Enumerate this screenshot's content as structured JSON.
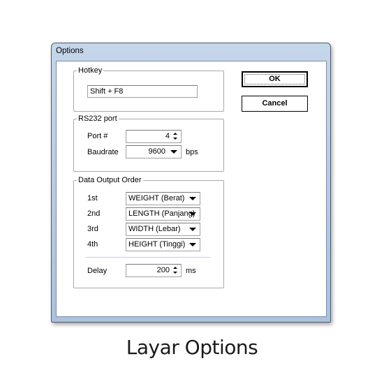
{
  "window": {
    "title": "Options"
  },
  "hotkey": {
    "group_title": "Hotkey",
    "value": "Shift + F8"
  },
  "rs232": {
    "group_title": "RS232 port",
    "port_label": "Port #",
    "port_value": "4",
    "baud_label": "Baudrate",
    "baud_value": "9600",
    "baud_unit": "bps"
  },
  "output": {
    "group_title": "Data Output Order",
    "rows": [
      {
        "label": "1st",
        "value": "WEIGHT (Berat)"
      },
      {
        "label": "2nd",
        "value": "LENGTH (Panjang)"
      },
      {
        "label": "3rd",
        "value": "WIDTH (Lebar)"
      },
      {
        "label": "4th",
        "value": "HEIGHT (Tinggi)"
      }
    ],
    "delay_label": "Delay",
    "delay_value": "200",
    "delay_unit": "ms"
  },
  "buttons": {
    "ok": "OK",
    "cancel": "Cancel"
  },
  "caption": "Layar Options"
}
